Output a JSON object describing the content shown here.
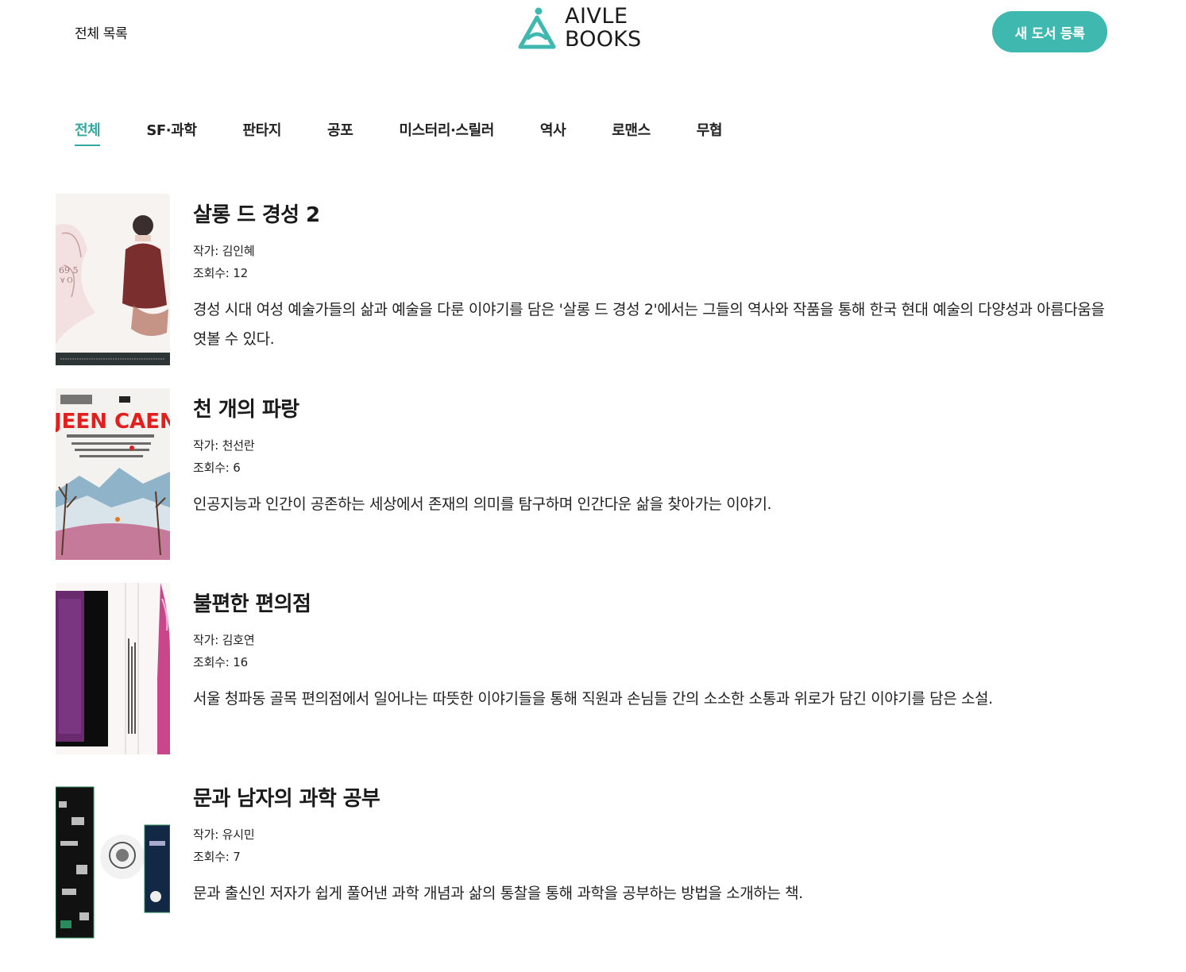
{
  "header": {
    "nav_all_label": "전체 목록",
    "logo_line1": "AIVLE",
    "logo_line2": "BOOKS",
    "new_book_label": "새 도서 등록"
  },
  "colors": {
    "accent": "#3fb8b0",
    "accent_text": "#2fa9a1"
  },
  "tabs": [
    {
      "label": "전체",
      "active": true
    },
    {
      "label": "SF·과학",
      "active": false
    },
    {
      "label": "판타지",
      "active": false
    },
    {
      "label": "공포",
      "active": false
    },
    {
      "label": "미스터리·스릴러",
      "active": false
    },
    {
      "label": "역사",
      "active": false
    },
    {
      "label": "로맨스",
      "active": false
    },
    {
      "label": "무협",
      "active": false
    }
  ],
  "books": [
    {
      "title": "살롱 드 경성 2",
      "author_label": "작가: 김인혜",
      "views_label": "조회수: 12",
      "description": "경성 시대 여성 예술가들의 삶과 예술을 다룬 이야기를 담은 '살롱 드 경성 2'에서는 그들의 역사와 작품을 통해 한국 현대 예술의 다양성과 아름다움을 엿볼 수 있다."
    },
    {
      "title": "천 개의 파랑",
      "author_label": "작가: 천선란",
      "views_label": "조회수: 6",
      "description": "인공지능과 인간이 공존하는 세상에서 존재의 의미를 탐구하며 인간다운 삶을 찾아가는 이야기.",
      "cover_text": "JEEN CAEN"
    },
    {
      "title": "불편한 편의점",
      "author_label": "작가: 김호연",
      "views_label": "조회수: 16",
      "description": "서울 청파동 골목 편의점에서 일어나는 따뜻한 이야기들을 통해 직원과 손님들 간의 소소한 소통과 위로가 담긴 이야기를 담은 소설."
    },
    {
      "title": "문과 남자의 과학 공부",
      "author_label": "작가: 유시민",
      "views_label": "조회수: 7",
      "description": "문과 출신인 저자가 쉽게 풀어낸 과학 개념과 삶의 통찰을 통해 과학을 공부하는 방법을 소개하는 책."
    }
  ]
}
